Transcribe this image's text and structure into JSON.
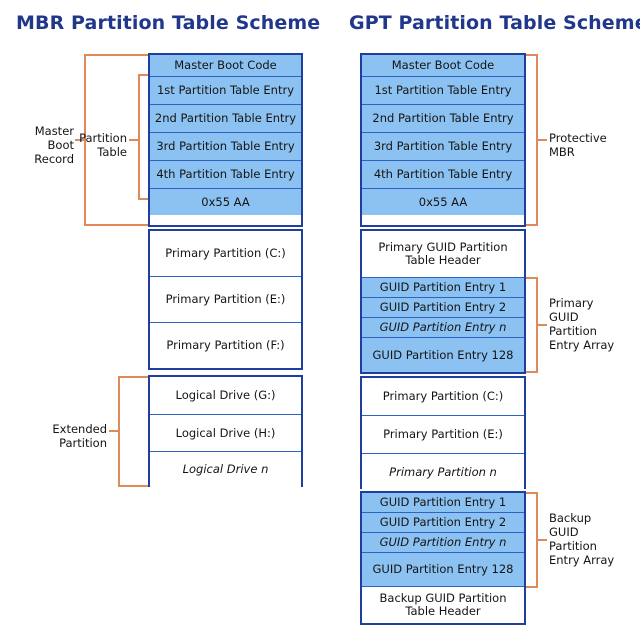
{
  "titles": {
    "mbr": "MBR Partition Table Scheme",
    "gpt": "GPT Partition Table Scheme"
  },
  "colors": {
    "title_blue": "#21378c",
    "block_fill_blue": "#8cc2f2",
    "block_border": "#1f3fa0",
    "row_divider": "#2f62c4",
    "bracket_orange": "#e08a5a",
    "background": "#ffffff"
  },
  "mbr": {
    "mbr_block": {
      "rows": [
        "Master Boot Code",
        "1st Partition Table Entry",
        "2nd Partition Table Entry",
        "3rd Partition Table Entry",
        "4th Partition Table Entry",
        "0x55 AA"
      ]
    },
    "primary_block": {
      "rows": [
        "Primary Partition (C:)",
        "Primary Partition (E:)",
        "Primary Partition (F:)"
      ]
    },
    "logical_block": {
      "rows": [
        "Logical Drive (G:)",
        "Logical Drive (H:)",
        "Logical Drive n"
      ]
    },
    "brackets": {
      "master_boot_record": "Master\nBoot\nRecord",
      "partition_table": "Partition\nTable",
      "extended_partition": "Extended\nPartition"
    }
  },
  "gpt": {
    "protective_mbr_block": {
      "rows": [
        "Master Boot Code",
        "1st Partition Table Entry",
        "2nd Partition Table Entry",
        "3rd Partition Table Entry",
        "4th Partition Table Entry",
        "0x55 AA"
      ]
    },
    "primary_header_row": "Primary GUID Partition Table Header",
    "primary_entry_array": {
      "rows": [
        "GUID Partition Entry 1",
        "GUID Partition Entry 2",
        "GUID Partition Entry n",
        "GUID Partition Entry 128"
      ]
    },
    "partitions_block": {
      "rows": [
        "Primary Partition (C:)",
        "Primary Partition (E:)",
        "Primary Partition n"
      ]
    },
    "backup_entry_array": {
      "rows": [
        "GUID Partition Entry 1",
        "GUID Partition Entry 2",
        "GUID Partition Entry n",
        "GUID Partition Entry 128"
      ]
    },
    "backup_header_row": "Backup GUID Partition Table Header",
    "brackets": {
      "protective_mbr": "Protective\nMBR",
      "primary_guid_array": "Primary\nGUID\nPartition\nEntry Array",
      "backup_guid_array": "Backup\nGUID\nPartition\nEntry Array"
    }
  }
}
